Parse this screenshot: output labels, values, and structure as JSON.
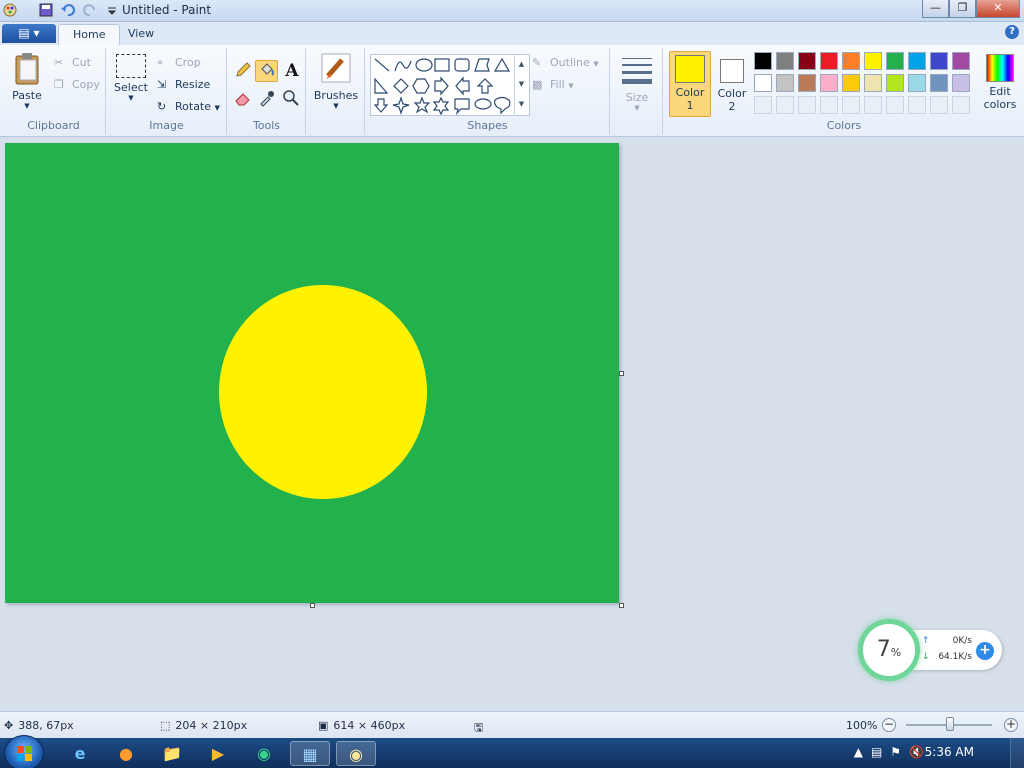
{
  "window": {
    "title": "Untitled - Paint"
  },
  "tabs": {
    "app_menu_icon": "paint-menu-icon",
    "home": "Home",
    "view": "View",
    "help_symbol": "?"
  },
  "ribbon": {
    "clipboard": {
      "label": "Clipboard",
      "paste": "Paste",
      "cut": "Cut",
      "copy": "Copy"
    },
    "image": {
      "label": "Image",
      "select": "Select",
      "crop": "Crop",
      "resize": "Resize",
      "rotate": "Rotate"
    },
    "tools": {
      "label": "Tools",
      "text_tool": "A"
    },
    "brushes": {
      "label": "Brushes"
    },
    "shapes": {
      "label": "Shapes",
      "outline": "Outline",
      "fill": "Fill"
    },
    "size": {
      "label": "Size"
    },
    "colors": {
      "label": "Colors",
      "color1_label": "Color",
      "color1_num": "1",
      "color2_label": "Color",
      "color2_num": "2",
      "edit_colors": "Edit",
      "edit_colors_2": "colors",
      "color1": "#fff200",
      "color2": "#ffffff",
      "palette_row1": [
        "#000000",
        "#7f7f7f",
        "#880015",
        "#ed1c24",
        "#ff7f27",
        "#fff200",
        "#22b14c",
        "#00a2e8",
        "#3f48cc",
        "#a349a4"
      ],
      "palette_row2": [
        "#ffffff",
        "#c3c3c3",
        "#b97a57",
        "#ffaec9",
        "#ffc90e",
        "#efe4b0",
        "#b5e61d",
        "#99d9ea",
        "#7092be",
        "#c8bfe7"
      ]
    }
  },
  "canvas": {
    "background": "#22b14c",
    "circle_fill": "#fff200"
  },
  "net_widget": {
    "cpu_value": "7",
    "cpu_unit": "%",
    "upload": "0K/s",
    "download": "64.1K/s"
  },
  "status_bar": {
    "cursor_pos": "388, 67px",
    "selection_size": "204 × 210px",
    "canvas_size": "614 × 460px",
    "zoom": "100%"
  },
  "taskbar": {
    "clock": "5:36 AM"
  }
}
